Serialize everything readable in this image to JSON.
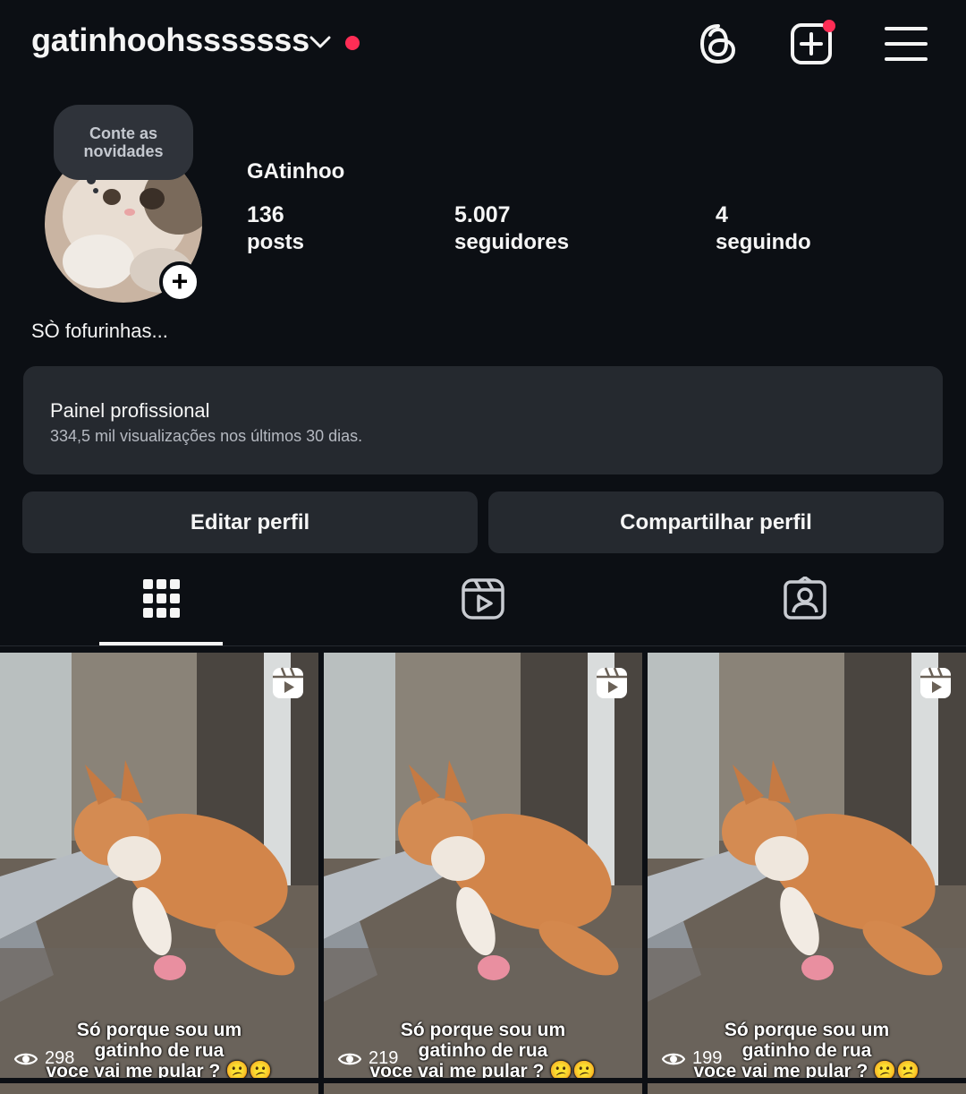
{
  "header": {
    "username": "gatinhoohsssssss",
    "icons": [
      "chevron-down-icon",
      "threads-icon",
      "create-post-icon",
      "menu-icon"
    ],
    "notification_color": "#ff2d55"
  },
  "profile": {
    "note_bubble": "Conte as novidades",
    "display_name": "GAtinhoo",
    "posts_count": "136",
    "posts_label": "posts",
    "followers_count": "5.007",
    "followers_label": "seguidores",
    "following_count": "4",
    "following_label": "seguindo",
    "bio": "SÒ fofurinhas...",
    "add_story": "+"
  },
  "dashboard": {
    "title": "Painel profissional",
    "subtitle": "334,5 mil visualizações nos últimos 30 dias."
  },
  "actions": {
    "edit": "Editar perfil",
    "share": "Compartilhar perfil"
  },
  "tabs": [
    "grid-icon",
    "reels-icon",
    "tagged-icon"
  ],
  "posts": [
    {
      "views": "298",
      "caption_l1": "Só porque sou um",
      "caption_l2": "gatinho de rua",
      "caption_l3": "voce vai me pular ? 😕😕"
    },
    {
      "views": "219",
      "caption_l1": "Só porque sou um",
      "caption_l2": "gatinho de rua",
      "caption_l3": "voce vai me pular ? 😕😕"
    },
    {
      "views": "199",
      "caption_l1": "Só porque sou um",
      "caption_l2": "gatinho de rua",
      "caption_l3": "voce vai me pular ? 😕😕"
    }
  ]
}
